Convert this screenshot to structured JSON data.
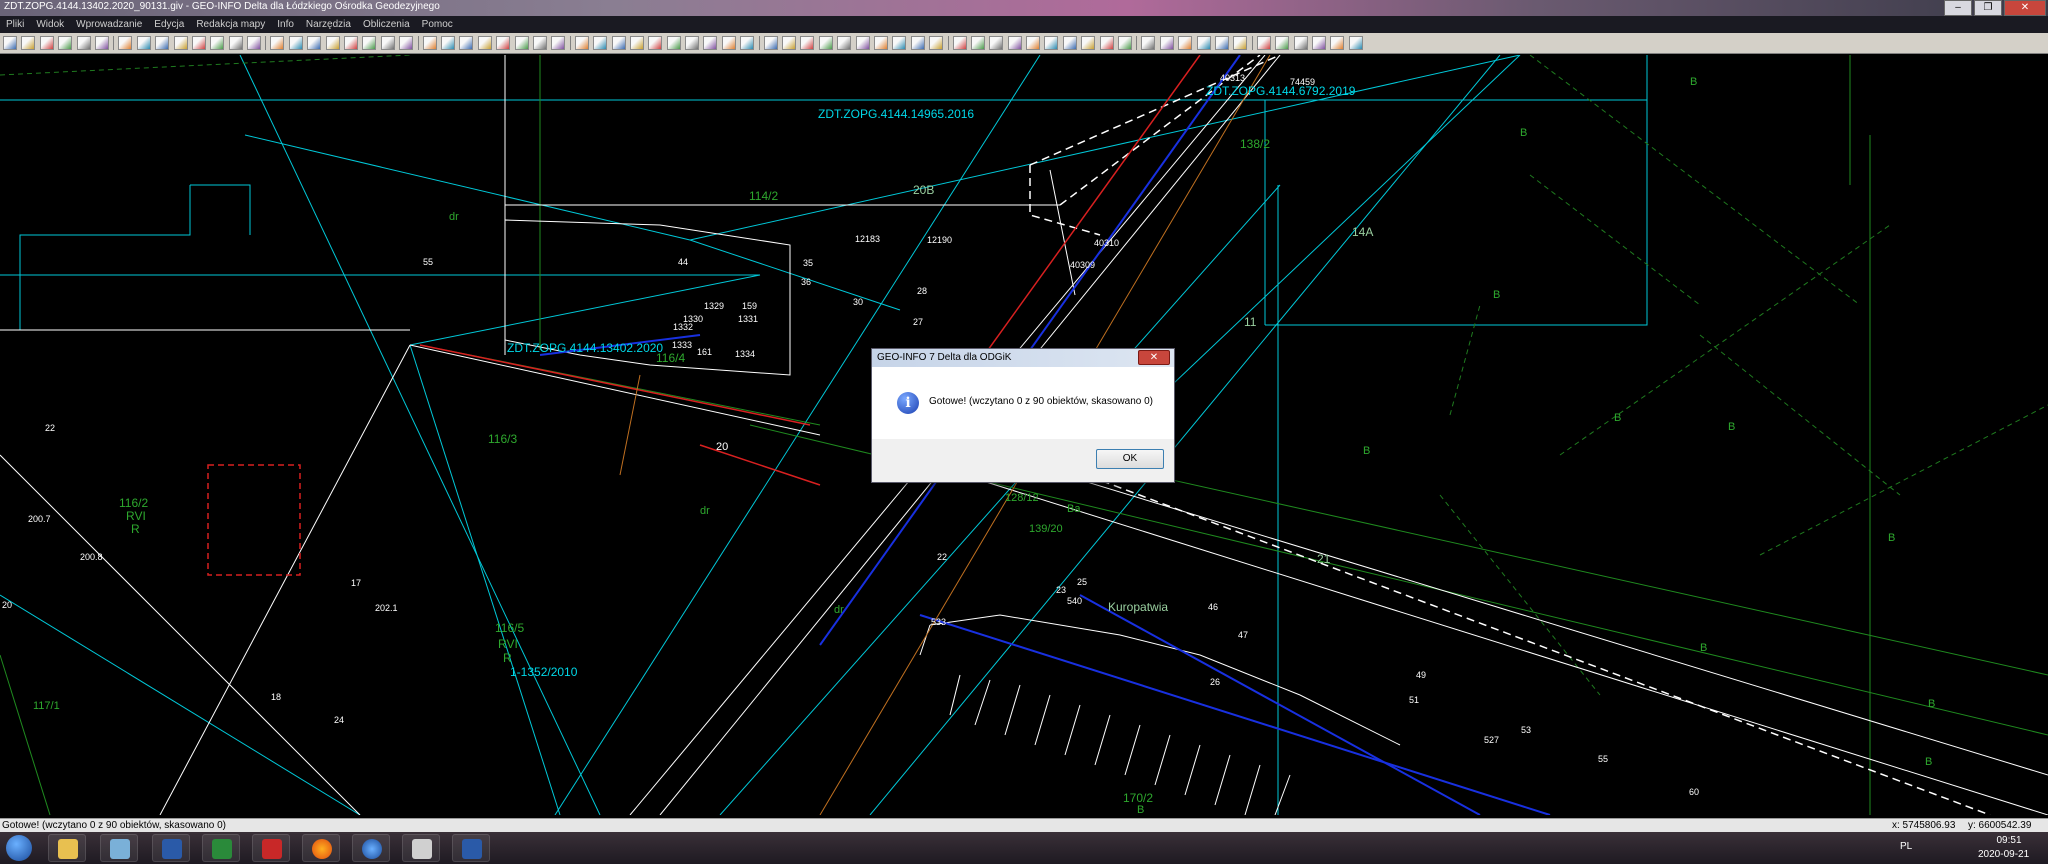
{
  "window": {
    "title": "ZDT.ZOPG.4144.13402.2020_90131.giv - GEO-INFO Delta dla Łódzkiego Ośrodka Geodezyjnego",
    "minimize": "–",
    "maximize": "❐",
    "close": "✕"
  },
  "menu": [
    "Pliki",
    "Widok",
    "Wprowadzanie",
    "Edycja",
    "Redakcja mapy",
    "Info",
    "Narzędzia",
    "Obliczenia",
    "Pomoc"
  ],
  "map": {
    "labels_cyan": [
      "ZDT.ZOPG.4144.14965.2016",
      "ZDT.ZOPG.4144.6792.2019",
      "ZDT.ZOPG.4144.13402.2020",
      "1-1352/2010"
    ],
    "labels_green": [
      "114/2",
      "116/4",
      "116/3",
      "116/2",
      "RVI",
      "R",
      "116/5",
      "RVI",
      "R",
      "138/2",
      "B",
      "B",
      "B",
      "B",
      "B",
      "B",
      "B",
      "B",
      "B",
      "dr",
      "dr",
      "dr",
      "117/1",
      "170/2",
      "B",
      "Kuropatwia",
      "14A",
      "21",
      "20B",
      "11",
      "139/20",
      "Ba",
      "128/12",
      "B"
    ],
    "labels_white": [
      "200.7",
      "200.8",
      "202.1",
      "22",
      "17",
      "18",
      "24",
      "20",
      "55",
      "44",
      "35",
      "36",
      "159",
      "1329",
      "1331",
      "1330",
      "1332",
      "1333",
      "161",
      "1334",
      "159",
      "12183",
      "12190",
      "40310",
      "40309",
      "40313",
      "74459",
      "27",
      "28",
      "30",
      "46",
      "47",
      "49",
      "51",
      "53",
      "55",
      "60",
      "527",
      "533",
      "540",
      "20",
      "22",
      "23",
      "25",
      "26"
    ]
  },
  "dialog": {
    "title": "GEO-INFO 7 Delta dla ODGiK",
    "close": "✕",
    "icon": "info-icon",
    "message": "Gotowe! (wczytano 0 z 90 obiektów, skasowano 0)",
    "ok": "OK"
  },
  "status": {
    "message": "Gotowe! (wczytano 0 z 90 obiektów, skasowano 0)",
    "x": "x: 5745806.93",
    "y": "y: 6600542.39"
  },
  "taskbar": {
    "apps": [
      "start-orb",
      "explorer",
      "notepad",
      "word",
      "excel",
      "app-red",
      "firefox",
      "globe",
      "acrobat",
      "geo-info"
    ],
    "lang": "PL",
    "time": "09:51",
    "date": "2020-09-21"
  }
}
